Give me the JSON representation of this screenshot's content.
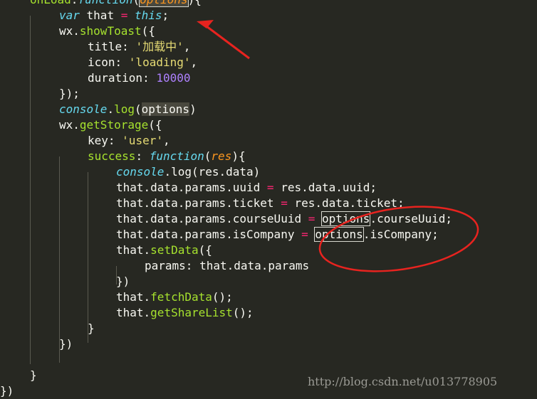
{
  "lines": [
    [
      [
        "fn",
        "onLoad"
      ],
      [
        "plain",
        ":"
      ],
      [
        "kw",
        "function"
      ],
      [
        "plain",
        "("
      ],
      [
        "param-box",
        "options"
      ],
      [
        "plain",
        "){"
      ]
    ],
    [
      [
        "kw",
        "var"
      ],
      [
        "plain",
        " that "
      ],
      [
        "op",
        "="
      ],
      [
        "plain",
        " "
      ],
      [
        "kw",
        "this"
      ],
      [
        "plain",
        ";"
      ]
    ],
    [
      [
        "plain",
        "wx."
      ],
      [
        "fn",
        "showToast"
      ],
      [
        "plain",
        "({"
      ]
    ],
    [
      [
        "plain",
        "title: "
      ],
      [
        "str",
        "'加载中'"
      ],
      [
        "plain",
        ","
      ]
    ],
    [
      [
        "plain",
        "icon: "
      ],
      [
        "str",
        "'loading'"
      ],
      [
        "plain",
        ","
      ]
    ],
    [
      [
        "plain",
        "duration: "
      ],
      [
        "num",
        "10000"
      ]
    ],
    [
      [
        "plain",
        "});"
      ]
    ],
    [
      [
        "it",
        "console"
      ],
      [
        "plain",
        "."
      ],
      [
        "fn",
        "log"
      ],
      [
        "plain",
        "("
      ],
      [
        "hl",
        "options"
      ],
      [
        "plain",
        ")"
      ]
    ],
    [
      [
        "plain",
        "wx."
      ],
      [
        "fn",
        "getStorage"
      ],
      [
        "plain",
        "({"
      ]
    ],
    [
      [
        "plain",
        "key: "
      ],
      [
        "str",
        "'user'"
      ],
      [
        "plain",
        ","
      ]
    ],
    [
      [
        "fn",
        "success"
      ],
      [
        "plain",
        ": "
      ],
      [
        "kw",
        "function"
      ],
      [
        "plain",
        "("
      ],
      [
        "param",
        "res"
      ],
      [
        "plain",
        "){"
      ]
    ],
    [
      [
        "it",
        "console"
      ],
      [
        "plain",
        "."
      ],
      [
        "plain",
        "log(res.data)"
      ]
    ],
    [
      [
        "plain",
        "that.data.params.uuid "
      ],
      [
        "op",
        "="
      ],
      [
        "plain",
        " res.data.uuid;"
      ]
    ],
    [
      [
        "plain",
        "that.data.params.ticket "
      ],
      [
        "op",
        "="
      ],
      [
        "plain",
        " res.data.ticket;"
      ]
    ],
    [
      [
        "plain",
        "that.data.params.courseUuid "
      ],
      [
        "op",
        "="
      ],
      [
        "plain",
        " "
      ],
      [
        "box",
        "options"
      ],
      [
        "plain",
        ".courseUuid;"
      ]
    ],
    [
      [
        "plain",
        "that.data.params.isCompany "
      ],
      [
        "op",
        "="
      ],
      [
        "plain",
        " "
      ],
      [
        "box",
        "options"
      ],
      [
        "plain",
        ".isCompany;"
      ]
    ],
    [
      [
        "plain",
        "that."
      ],
      [
        "fn",
        "setData"
      ],
      [
        "plain",
        "({"
      ]
    ],
    [
      [
        "plain",
        "params: that.data.params"
      ]
    ],
    [
      [
        "plain",
        "})"
      ]
    ],
    [
      [
        "plain",
        "that."
      ],
      [
        "fn",
        "fetchData"
      ],
      [
        "plain",
        "();"
      ]
    ],
    [
      [
        "plain",
        "that."
      ],
      [
        "fn",
        "getShareList"
      ],
      [
        "plain",
        "();"
      ]
    ],
    [
      [
        "plain",
        "}"
      ]
    ],
    [
      [
        "plain",
        "})"
      ]
    ],
    [
      [
        "plain",
        ""
      ]
    ],
    [
      [
        "plain",
        "}"
      ]
    ],
    [
      [
        "plain",
        "})"
      ]
    ]
  ],
  "watermark": "http://blog.csdn.net/u013778905"
}
